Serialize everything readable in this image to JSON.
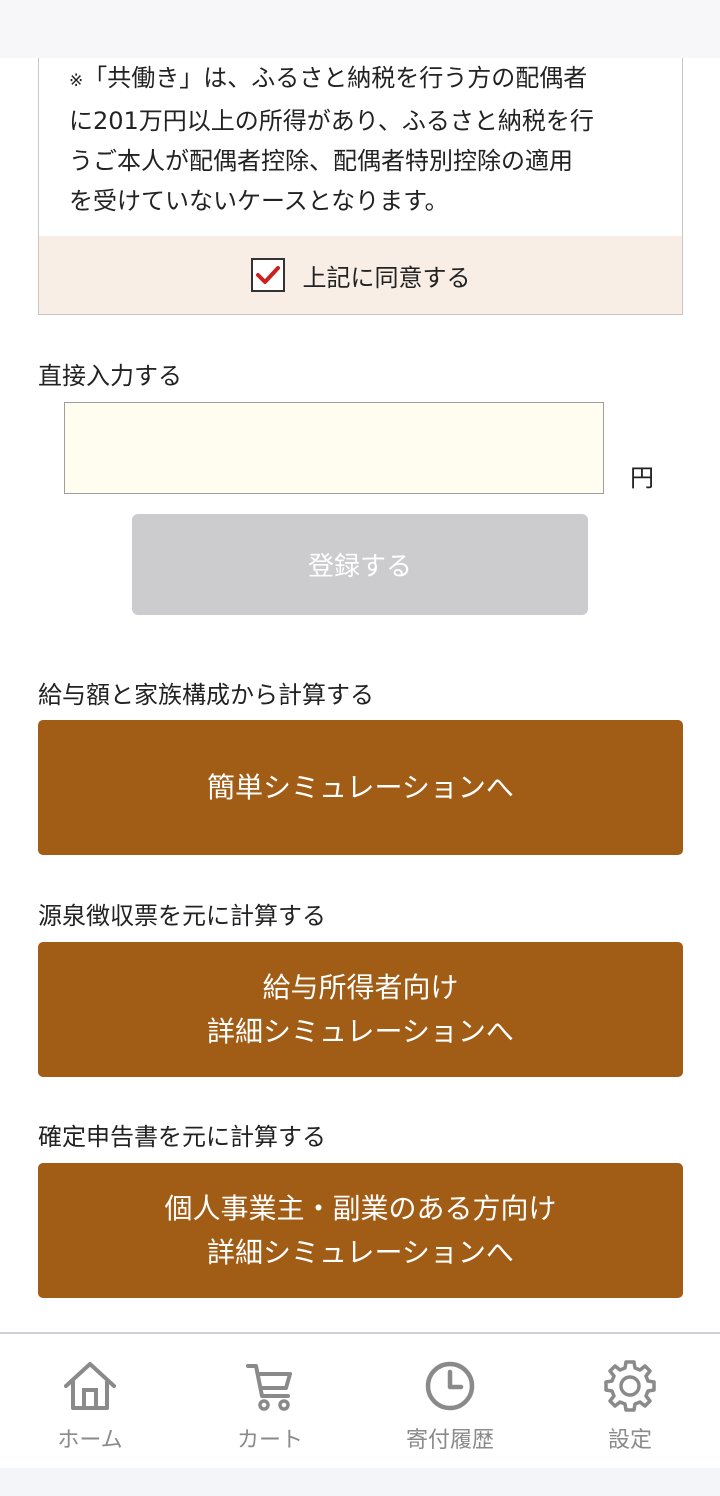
{
  "notice": {
    "mark": "※",
    "text": "「共働き」は、ふるさと納税を行う方の配偶者\nに201万円以上の所得があり、ふるさと納税を行\nうご本人が配偶者控除、配偶者特別控除の適用\nを受けていないケースとなります。",
    "agree_label": "上記に同意する",
    "agree_checked": true
  },
  "direct": {
    "label": "直接入力する",
    "input_value": "",
    "unit": "円",
    "register_label": "登録する"
  },
  "sections": [
    {
      "label": "給与額と家族構成から計算する",
      "button_lines": [
        "簡単シミュレーションへ"
      ]
    },
    {
      "label": "源泉徴収票を元に計算する",
      "button_lines": [
        "給与所得者向け",
        "詳細シミュレーションへ"
      ]
    },
    {
      "label": "確定申告書を元に計算する",
      "button_lines": [
        "個人事業主・副業のある方向け",
        "詳細シミュレーションへ"
      ]
    }
  ],
  "tabs": [
    {
      "label": "ホーム",
      "icon": "home-icon"
    },
    {
      "label": "カート",
      "icon": "cart-icon"
    },
    {
      "label": "寄付履歴",
      "icon": "clock-icon"
    },
    {
      "label": "設定",
      "icon": "gear-icon"
    }
  ],
  "colors": {
    "accent": "#a15c16",
    "checkbox_check": "#cc1f1f",
    "agree_bg": "#f8eee6",
    "input_bg": "#fffdf0",
    "disabled_button": "#cccbce",
    "tab_inactive": "#8a8a8a"
  }
}
